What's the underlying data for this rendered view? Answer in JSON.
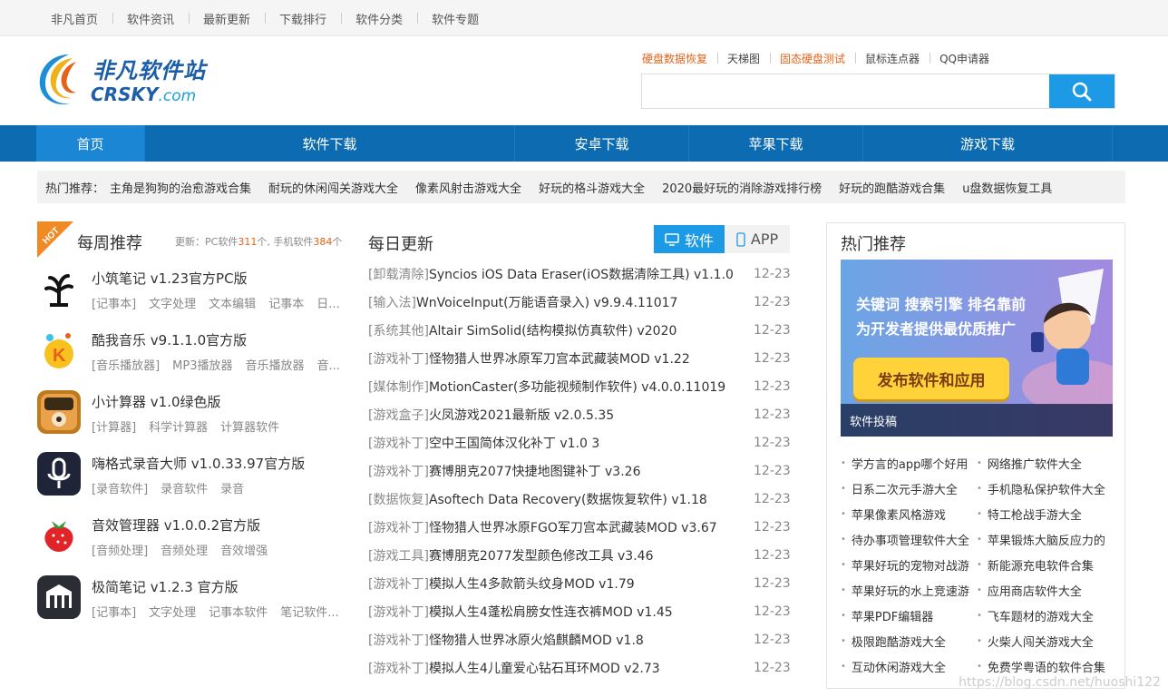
{
  "topbar": {
    "items": [
      "非凡首页",
      "软件资讯",
      "最新更新",
      "下载排行",
      "软件分类",
      "软件专题"
    ]
  },
  "logo": {
    "cn": "非凡软件站",
    "en": "CRSKY",
    "en_suffix": ".com"
  },
  "header": {
    "hotlinks": [
      {
        "label": "硬盘数据恢复",
        "orange": true
      },
      {
        "label": "天梯图",
        "orange": false
      },
      {
        "label": "固态硬盘测试",
        "orange": true
      },
      {
        "label": "鼠标连点器",
        "orange": false
      },
      {
        "label": "QQ申请器",
        "orange": false
      }
    ],
    "search_placeholder": ""
  },
  "nav": {
    "items": [
      "首页",
      "软件下载",
      "安卓下载",
      "苹果下载",
      "游戏下载"
    ],
    "active": 0
  },
  "hotbar": {
    "label": "热门推荐：",
    "items": [
      "主角是狗狗的治愈游戏合集",
      "耐玩的休闲闯关游戏大全",
      "像素风射击游戏大全",
      "好玩的格斗游戏大全",
      "2020最好玩的消除游戏排行榜",
      "好玩的跑酷游戏合集",
      "u盘数据恢复工具"
    ]
  },
  "weekly": {
    "title": "每周推荐",
    "hot": "HOT",
    "update_prefix": "更新：PC软件",
    "pc_count": "311",
    "mid": "个, 手机软件",
    "mobile_count": "384",
    "suffix": "个",
    "items": [
      {
        "name": "小筑笔记 v1.23官方PC版",
        "tags": [
          "[记事本]",
          "文字处理",
          "文本编辑",
          "记事本",
          "日..."
        ],
        "icon": "tree-icon"
      },
      {
        "name": "酷我音乐 v9.1.1.0官方版",
        "tags": [
          "[音乐播放器]",
          "MP3播放器",
          "音乐播放器",
          "音..."
        ],
        "icon": "kuwo-icon"
      },
      {
        "name": "小计算器 v1.0绿色版",
        "tags": [
          "[计算器]",
          "科学计算器",
          "计算器软件"
        ],
        "icon": "calculator-icon"
      },
      {
        "name": "嗨格式录音大师 v1.0.33.97官方版",
        "tags": [
          "[录音软件]",
          "录音软件",
          "录音"
        ],
        "icon": "microphone-icon"
      },
      {
        "name": "音效管理器 v1.0.0.2官方版",
        "tags": [
          "[音频处理]",
          "音频处理",
          "音效增强"
        ],
        "icon": "strawberry-icon"
      },
      {
        "name": "极简笔记 v1.2.3 官方版",
        "tags": [
          "[记事本]",
          "文字处理",
          "记事本软件",
          "笔记软件..."
        ],
        "icon": "notes-icon"
      }
    ]
  },
  "daily": {
    "title": "每日更新",
    "tabs": [
      "软件",
      "APP"
    ],
    "rows": [
      {
        "cat": "[卸载清除]",
        "name": "Syncios iOS Data Eraser(iOS数据清除工具) v1.1.0",
        "date": "12-23"
      },
      {
        "cat": "[输入法]",
        "name": "WnVoiceInput(万能语音录入) v9.9.4.11017",
        "date": "12-23"
      },
      {
        "cat": "[系统其他]",
        "name": "Altair SimSolid(结构模拟仿真软件) v2020",
        "date": "12-23"
      },
      {
        "cat": "[游戏补丁]",
        "name": "怪物猎人世界冰原军刀宫本武藏装MOD v1.22",
        "date": "12-23"
      },
      {
        "cat": "[媒体制作]",
        "name": "MotionCaster(多功能视频制作软件) v4.0.0.11019",
        "date": "12-23"
      },
      {
        "cat": "[游戏盒子]",
        "name": "火凤游戏2021最新版 v2.0.5.35",
        "date": "12-23"
      },
      {
        "cat": "[游戏补丁]",
        "name": "空中王国简体汉化补丁 v1.0 3",
        "date": "12-23"
      },
      {
        "cat": "[游戏补丁]",
        "name": "赛博朋克2077快捷地图键补丁 v3.26",
        "date": "12-23"
      },
      {
        "cat": "[数据恢复]",
        "name": "Asoftech Data Recovery(数据恢复软件) v1.18",
        "date": "12-23"
      },
      {
        "cat": "[游戏补丁]",
        "name": "怪物猎人世界冰原FGO军刀宫本武藏装MOD v3.67",
        "date": "12-23"
      },
      {
        "cat": "[游戏工具]",
        "name": "赛博朋克2077发型颜色修改工具 v3.46",
        "date": "12-23"
      },
      {
        "cat": "[游戏补丁]",
        "name": "模拟人生4多款箭头纹身MOD v1.79",
        "date": "12-23"
      },
      {
        "cat": "[游戏补丁]",
        "name": "模拟人生4蓬松肩膀女性连衣裤MOD v1.45",
        "date": "12-23"
      },
      {
        "cat": "[游戏补丁]",
        "name": "怪物猎人世界冰原火焰麒麟MOD v1.8",
        "date": "12-23"
      },
      {
        "cat": "[游戏补丁]",
        "name": "模拟人生4儿童爱心钻石耳环MOD v2.73",
        "date": "12-23"
      }
    ]
  },
  "hot": {
    "title": "热门推荐",
    "banner": {
      "line1": "关键词  搜索引擎  排名靠前",
      "line2": "为开发者提供最优质推广",
      "cta": "发布软件和应用",
      "caption": "软件投稿"
    },
    "links": [
      "学方言的app哪个好用",
      "网络推广软件大全",
      "日系二次元手游大全",
      "手机隐私保护软件大全",
      "苹果像素风格游戏",
      "特工枪战手游大全",
      "待办事项管理软件大全",
      "苹果锻炼大脑反应力的",
      "苹果好玩的宠物对战游",
      "新能源充电软件合集",
      "苹果好玩的水上竞速游",
      "应用商店软件大全",
      "苹果PDF编辑器",
      "飞车题材的游戏大全",
      "极限跑酷游戏大全",
      "火柴人闯关游戏大全",
      "互动休闲游戏大全",
      "免费学粤语的软件合集"
    ]
  },
  "watermark": "https://blog.csdn.net/huoshi122",
  "colors": {
    "nav": "#0d6bb2",
    "accent": "#1d9ae6",
    "orange": "#e5621a"
  }
}
